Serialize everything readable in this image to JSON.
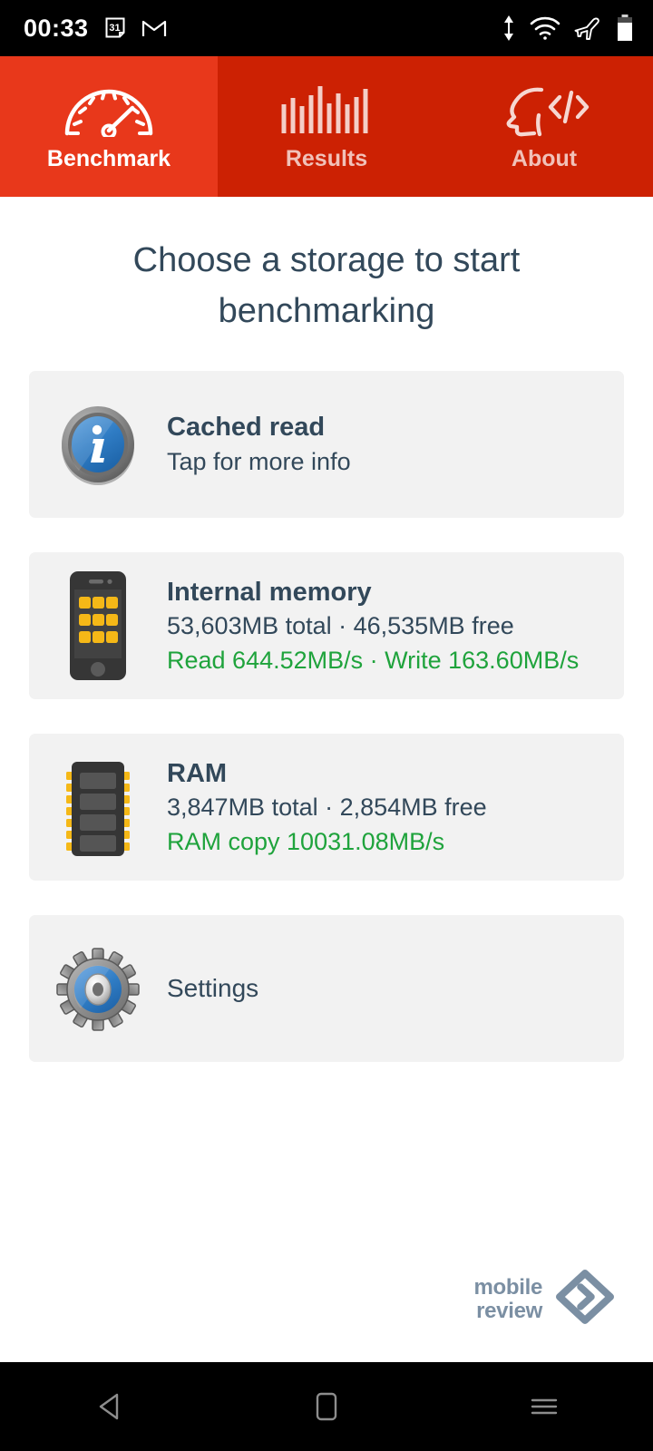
{
  "status_bar": {
    "time": "00:33",
    "left_icons": [
      "calendar-31-icon",
      "gmail-icon"
    ],
    "calendar_day": "31",
    "right_icons": [
      "data-transfer-icon",
      "wifi-icon",
      "airplane-mode-icon",
      "battery-icon"
    ]
  },
  "tabs": [
    {
      "label": "Benchmark",
      "icon": "speedometer-icon",
      "active": true
    },
    {
      "label": "Results",
      "icon": "bar-chart-icon",
      "active": false
    },
    {
      "label": "About",
      "icon": "head-code-icon",
      "active": false
    }
  ],
  "main": {
    "title": "Choose a storage to start benchmarking",
    "cards": [
      {
        "id": "cached-read",
        "icon": "info-icon",
        "title": "Cached read",
        "subtitle": "Tap for more info",
        "speed": ""
      },
      {
        "id": "internal-memory",
        "icon": "phone-icon",
        "title": "Internal memory",
        "subtitle": "53,603MB total · 46,535MB free",
        "speed": "Read 644.52MB/s · Write 163.60MB/s"
      },
      {
        "id": "ram",
        "icon": "ram-module-icon",
        "title": "RAM",
        "subtitle": "3,847MB total · 2,854MB free",
        "speed": "RAM copy 10031.08MB/s"
      },
      {
        "id": "settings",
        "icon": "gear-icon",
        "title": "Settings",
        "subtitle": "",
        "speed": ""
      }
    ]
  },
  "footer": {
    "logo_line1": "mobile",
    "logo_line2": "review",
    "logo_mark": "diamond-arrow-icon"
  },
  "nav_bar": {
    "back": "back-icon",
    "home": "home-icon",
    "recents": "recents-icon"
  },
  "colors": {
    "tab_active": "#e8381b",
    "tab_inactive": "#cc2103",
    "text_primary": "#32485a",
    "speed_green": "#1fa33c",
    "card_bg": "#f2f2f2",
    "logo_gray": "#7b8fa3"
  }
}
